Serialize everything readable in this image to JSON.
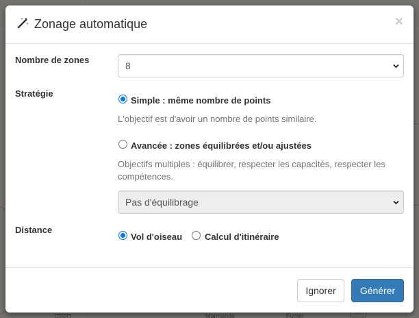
{
  "modal": {
    "title": "Zonage automatique",
    "close_symbol": "×",
    "icon": "magic-wand-icon"
  },
  "zones": {
    "label": "Nombre de zones",
    "selected": "8"
  },
  "strategy": {
    "label": "Stratégie",
    "simple_label": "Simple : même nombre de points",
    "simple_help": "L'objectif est d'avoir un nombre de points similaire.",
    "simple_checked": true,
    "advanced_label": "Avancée : zones équilibrées et/ou ajustées",
    "advanced_help": "Objectifs multiples : équilibrer, respecter les capacités, respecter les compétences.",
    "advanced_checked": false,
    "balancing_selected": "Pas d'équilibrage"
  },
  "distance": {
    "label": "Distance",
    "as_crow_label": "Vol d'oiseau",
    "as_crow_checked": true,
    "route_label": "Calcul d'itinéraire",
    "route_checked": false
  },
  "footer": {
    "ignore_label": "Ignorer",
    "generate_label": "Générer"
  },
  "colors": {
    "primary": "#337ab7",
    "radio_accent": "#0075ff",
    "help_text": "#737373"
  }
}
